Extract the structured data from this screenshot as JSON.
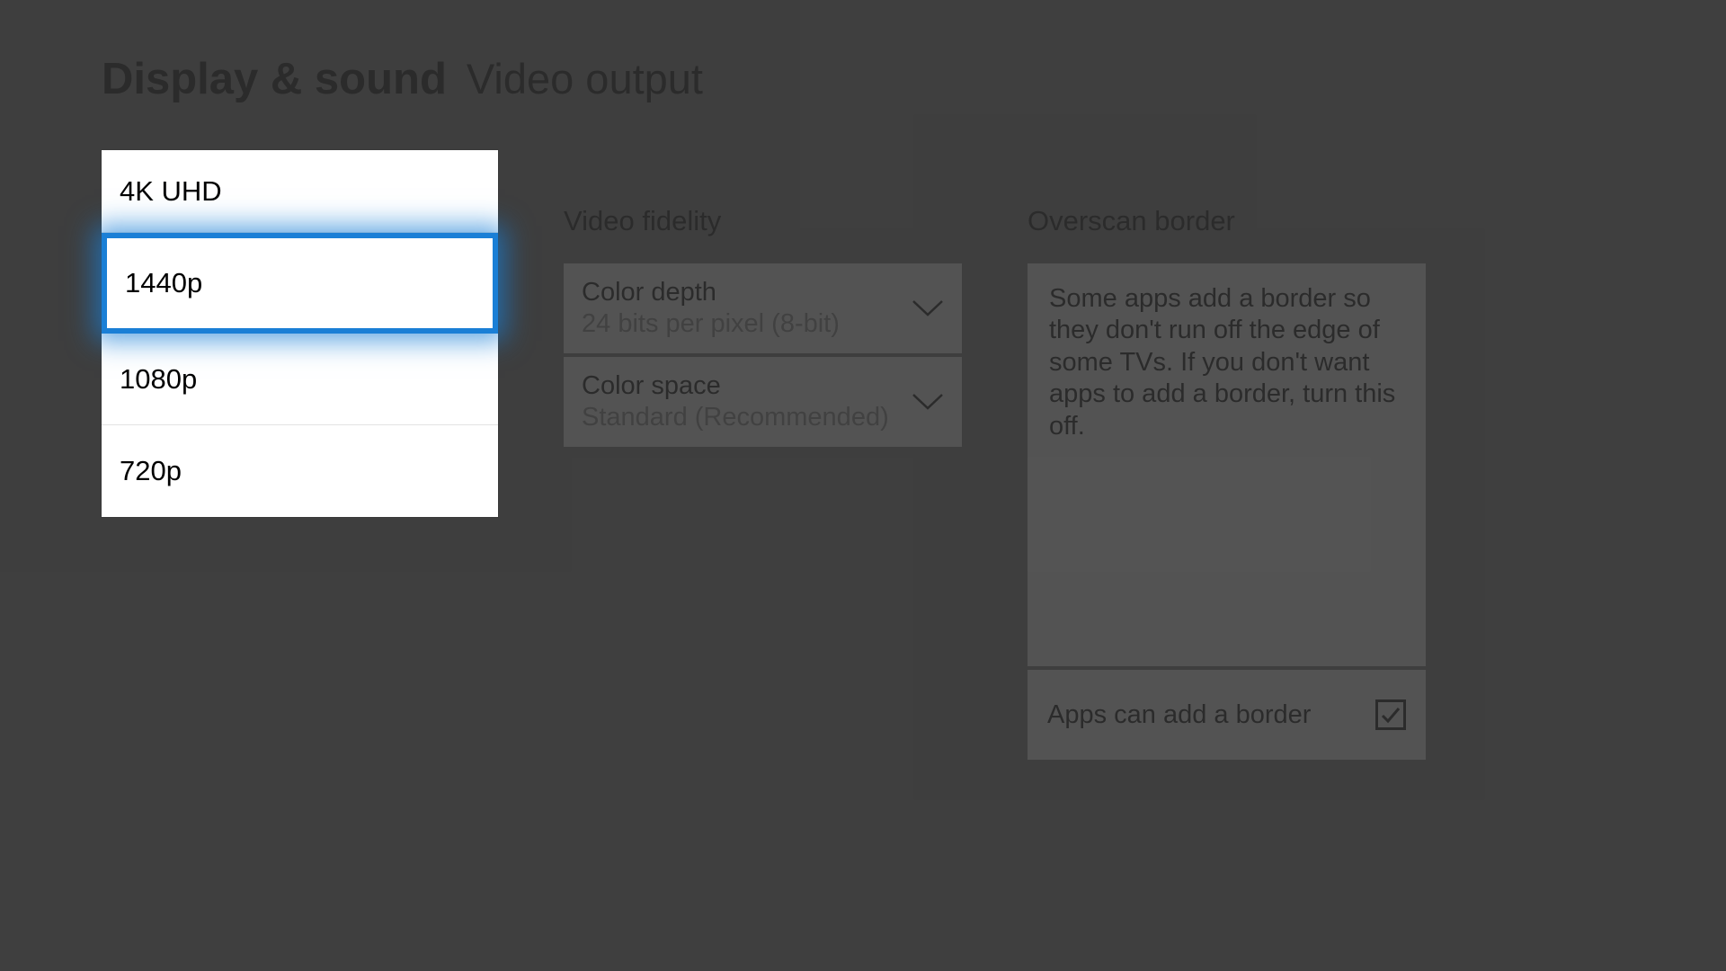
{
  "header": {
    "main": "Display & sound",
    "sub": "Video output"
  },
  "resolution_options": {
    "items": [
      "4K UHD",
      "1440p",
      "1080p",
      "720p"
    ],
    "selected_index": 1
  },
  "video_fidelity": {
    "title": "Video fidelity",
    "color_depth": {
      "label": "Color depth",
      "value": "24 bits per pixel (8-bit)"
    },
    "color_space": {
      "label": "Color space",
      "value": "Standard (Recommended)"
    }
  },
  "overscan": {
    "title": "Overscan border",
    "description": "Some apps add a border so they don't run off the edge of some TVs. If you don't want apps to add a border, turn this off.",
    "checkbox_label": "Apps can add a border",
    "checked": true
  }
}
